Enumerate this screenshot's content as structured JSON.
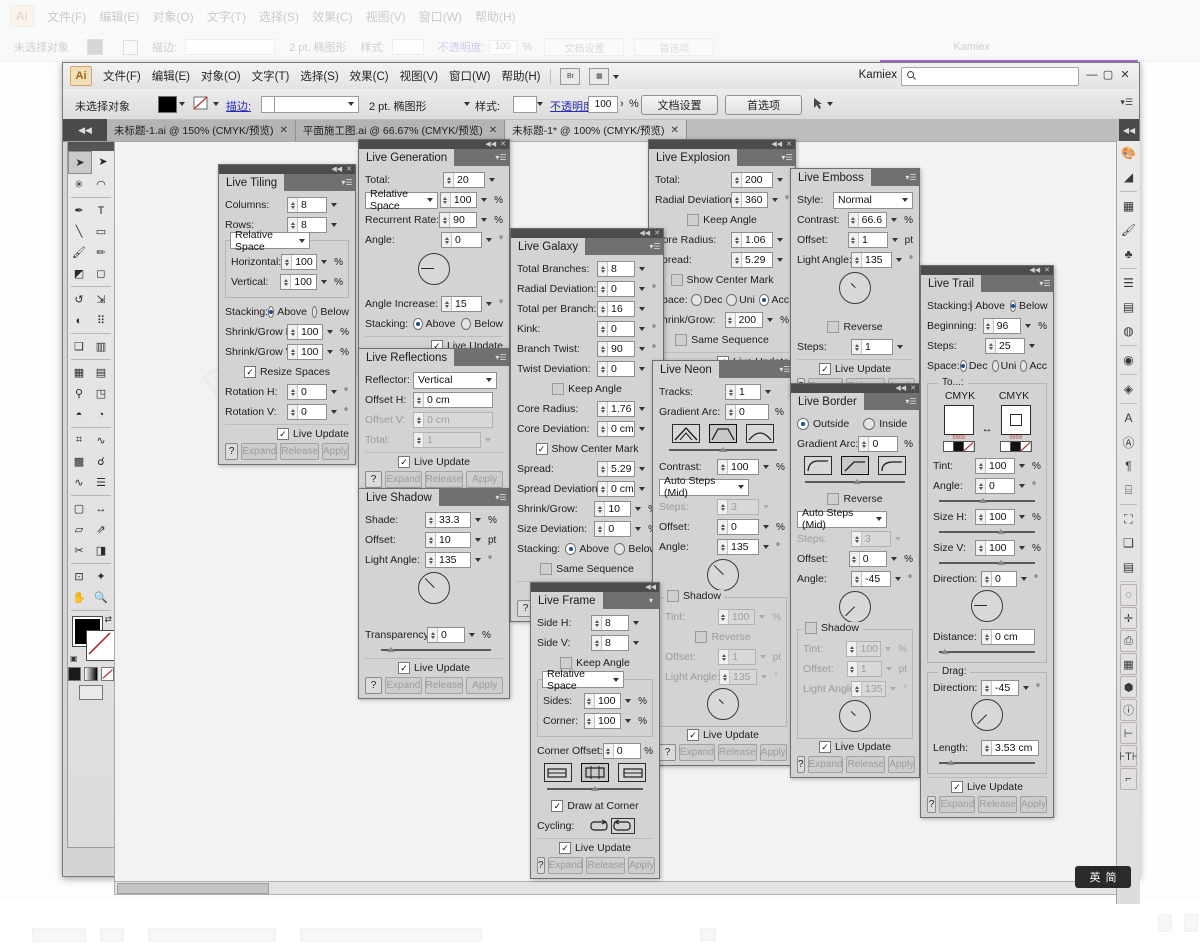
{
  "background_window": {
    "menus": [
      "文件(F)",
      "编辑(E)",
      "对象(O)",
      "文字(T)",
      "选择(S)",
      "效果(C)",
      "视图(V)",
      "窗口(W)",
      "帮助(H)"
    ],
    "logo": "Ai",
    "control": {
      "selection_status": "未选择对象",
      "stroke_label": "描边:",
      "stroke_preset": "2 pt. 椭图形",
      "style_label": "样式:",
      "opacity_label": "不透明度:",
      "opacity_value": "100",
      "percent": "%",
      "doc_setup": "文档设置",
      "preferences": "首选项"
    },
    "user": "Kamiex"
  },
  "window": {
    "logo": "Ai",
    "menus": [
      "文件(F)",
      "编辑(E)",
      "对象(O)",
      "文字(T)",
      "选择(S)",
      "效果(C)",
      "视图(V)",
      "窗口(W)",
      "帮助(H)"
    ],
    "bridge_icon": "Br",
    "arrange_icon": "▦",
    "user": "Kamiex",
    "search_placeholder": "",
    "minimize": "—",
    "maximize": "▢",
    "close": "✕"
  },
  "control_bar": {
    "selection_status": "未选择对象",
    "stroke_label": "描边:",
    "stroke_weight": "2 pt. 椭图形",
    "style_label": "样式:",
    "opacity_label": "不透明度:",
    "opacity_value": "100",
    "percent_sign": "%",
    "doc_setup_button": "文档设置",
    "preferences_button": "首选项"
  },
  "tabs": [
    {
      "label": "未标题-1.ai @ 150% (CMYK/预览)",
      "active": false
    },
    {
      "label": "平面施工图.ai @ 66.67% (CMYK/预览)",
      "active": false
    },
    {
      "label": "未标题-1* @ 100% (CMYK/预览)",
      "active": true
    }
  ],
  "canvas": {
    "watermark": "PHOTOTO CN",
    "watermark2": "图行天下"
  },
  "ime": {
    "lang": "英",
    "mode": "简"
  },
  "common": {
    "live_update": "Live Update",
    "expand": "Expand",
    "release": "Release",
    "apply": "Apply",
    "help": "?",
    "above": "Above",
    "below": "Below",
    "stacking": "Stacking:",
    "keep_angle": "Keep Angle",
    "relative_space": "Relative Space",
    "same_sequence": "Same Sequence",
    "show_center_mark": "Show Center Mark",
    "reverse": "Reverse",
    "shadow": "Shadow",
    "auto_steps_mid": "Auto Steps (Mid)"
  },
  "panels": {
    "live_tiling": {
      "title": "Live Tiling",
      "columns_label": "Columns:",
      "columns_value": "8",
      "rows_label": "Rows:",
      "rows_value": "8",
      "space_mode": "Relative Space",
      "horizontal_label": "Horizontal:",
      "horizontal_value": "100",
      "horizontal_unit": "%",
      "vertical_label": "Vertical:",
      "vertical_value": "100",
      "vertical_unit": "%",
      "stacking_label": "Stacking:",
      "stacking_value": "Above",
      "shrink_h_label": "Shrink/Grow H:",
      "shrink_h_value": "100",
      "shrink_h_unit": "%",
      "shrink_v_label": "Shrink/Grow V:",
      "shrink_v_value": "100",
      "shrink_v_unit": "%",
      "resize_spaces": "Resize Spaces",
      "resize_spaces_checked": true,
      "rotation_h_label": "Rotation H:",
      "rotation_h_value": "0",
      "rotation_h_unit": "°",
      "rotation_v_label": "Rotation V:",
      "rotation_v_value": "0",
      "rotation_v_unit": "°",
      "live_update_checked": true
    },
    "live_generation": {
      "title": "Live Generation",
      "total_label": "Total:",
      "total_value": "20",
      "space_mode": "Relative Space",
      "space_value": "100",
      "space_unit": "%",
      "recurrent_label": "Recurrent Rate:",
      "recurrent_value": "90",
      "recurrent_unit": "%",
      "angle_label": "Angle:",
      "angle_value": "0",
      "angle_unit": "°",
      "angle_increase_label": "Angle Increase:",
      "angle_increase_value": "15",
      "angle_increase_unit": "°",
      "stacking_label": "Stacking:",
      "stacking_value": "Above",
      "live_update_checked": true
    },
    "live_reflections": {
      "title": "Live Reflections",
      "reflector_label": "Reflector:",
      "reflector_value": "Vertical",
      "offset_h_label": "Offset H:",
      "offset_h_value": "0 cm",
      "offset_v_label": "Offset V:",
      "offset_v_value": "0 cm",
      "total_label": "Total:",
      "total_value": "1",
      "live_update_checked": true
    },
    "live_shadow": {
      "title": "Live Shadow",
      "shade_label": "Shade:",
      "shade_value": "33.3",
      "shade_unit": "%",
      "offset_label": "Offset:",
      "offset_value": "10",
      "offset_unit": "pt",
      "light_angle_label": "Light Angle:",
      "light_angle_value": "135",
      "light_angle_unit": "°",
      "transparency_label": "Transparency:",
      "transparency_value": "0",
      "transparency_unit": "%",
      "live_update_checked": true
    },
    "live_galaxy": {
      "title": "Live Galaxy",
      "total_branches_label": "Total Branches:",
      "total_branches_value": "8",
      "radial_dev_label": "Radial Deviation:",
      "radial_dev_value": "0",
      "radial_dev_unit": "°",
      "total_per_branch_label": "Total per Branch:",
      "total_per_branch_value": "16",
      "kink_label": "Kink:",
      "kink_value": "0",
      "kink_unit": "°",
      "branch_twist_label": "Branch Twist:",
      "branch_twist_value": "90",
      "branch_twist_unit": "°",
      "twist_dev_label": "Twist Deviation:",
      "twist_dev_value": "0",
      "twist_dev_unit": "°",
      "keep_angle_checked": false,
      "core_radius_label": "Core Radius:",
      "core_radius_value": "1.76",
      "core_dev_label": "Core Deviation:",
      "core_dev_value": "0 cm",
      "show_center_mark_checked": true,
      "spread_label": "Spread:",
      "spread_value": "5.29",
      "spread_dev_label": "Spread Deviation:",
      "spread_dev_value": "0 cm",
      "shrink_label": "Shrink/Grow:",
      "shrink_value": "10",
      "shrink_unit": "%",
      "size_dev_label": "Size Deviation:",
      "size_dev_value": "0",
      "size_dev_unit": "%",
      "stacking_label": "Stacking:",
      "stacking_value": "Above",
      "same_sequence_checked": false,
      "live_update_checked": true
    },
    "live_frame": {
      "title": "Live Frame",
      "side_h_label": "Side H:",
      "side_h_value": "8",
      "side_v_label": "Side V:",
      "side_v_value": "8",
      "keep_angle_checked": false,
      "space_mode": "Relative Space",
      "sides_label": "Sides:",
      "sides_value": "100",
      "sides_unit": "%",
      "corner_label": "Corner:",
      "corner_value": "100",
      "corner_unit": "%",
      "corner_offset_label": "Corner Offset:",
      "corner_offset_value": "0",
      "corner_offset_unit": "%",
      "draw_at_corner": "Draw at Corner",
      "draw_at_corner_checked": true,
      "cycling_label": "Cycling:",
      "live_update_checked": true
    },
    "live_explosion": {
      "title": "Live Explosion",
      "total_label": "Total:",
      "total_value": "200",
      "radial_dev_label": "Radial Deviation:",
      "radial_dev_value": "360",
      "radial_dev_unit": "°",
      "keep_angle_checked": false,
      "core_radius_label": "Core Radius:",
      "core_radius_value": "1.06",
      "spread_label": "Spread:",
      "spread_value": "5.29",
      "show_center_mark_checked": false,
      "space_label": "Space:",
      "space_dec": "Dec",
      "space_uni": "Uni",
      "space_acc": "Acc",
      "space_selected": "Acc",
      "shrink_label": "Shrink/Grow:",
      "shrink_value": "200",
      "shrink_unit": "%",
      "same_sequence_checked": false,
      "live_update_checked": true
    },
    "live_neon": {
      "title": "Live Neon",
      "tracks_label": "Tracks:",
      "tracks_value": "1",
      "gradient_arc_label": "Gradient Arc:",
      "gradient_arc_value": "0",
      "gradient_arc_unit": "%",
      "contrast_label": "Contrast:",
      "contrast_value": "100",
      "contrast_unit": "%",
      "auto_steps": "Auto Steps (Mid)",
      "steps_label": "Steps:",
      "steps_value": "3",
      "offset_label": "Offset:",
      "offset_value": "0",
      "offset_unit": "%",
      "angle_label": "Angle:",
      "angle_value": "135",
      "angle_unit": "°",
      "shadow_label": "Shadow",
      "shadow_checked": false,
      "tint_label": "Tint:",
      "tint_value": "100",
      "tint_unit": "%",
      "reverse_label": "Reverse",
      "reverse_checked": false,
      "sh_offset_label": "Offset:",
      "sh_offset_value": "1",
      "sh_offset_unit": "pt",
      "light_angle_label": "Light Angle:",
      "light_angle_value": "135",
      "light_angle_unit": "°",
      "live_update_checked": true
    },
    "live_emboss": {
      "title": "Live Emboss",
      "style_label": "Style:",
      "style_value": "Normal",
      "contrast_label": "Contrast:",
      "contrast_value": "66.6",
      "contrast_unit": "%",
      "offset_label": "Offset:",
      "offset_value": "1",
      "offset_unit": "pt",
      "light_angle_label": "Light Angle:",
      "light_angle_value": "135",
      "light_angle_unit": "°",
      "reverse_label": "Reverse",
      "reverse_checked": false,
      "steps_label": "Steps:",
      "steps_value": "1",
      "live_update_checked": true
    },
    "live_border": {
      "title": "Live Border",
      "outside_label": "Outside",
      "inside_label": "Inside",
      "side_selected": "Outside",
      "gradient_arc_label": "Gradient Arc:",
      "gradient_arc_value": "0",
      "gradient_arc_unit": "%",
      "reverse_label": "Reverse",
      "reverse_checked": false,
      "auto_steps": "Auto Steps (Mid)",
      "steps_label": "Steps:",
      "steps_value": "3",
      "offset_label": "Offset:",
      "offset_value": "0",
      "offset_unit": "%",
      "angle_label": "Angle:",
      "angle_value": "-45",
      "angle_unit": "°",
      "shadow_label": "Shadow",
      "shadow_checked": false,
      "tint_label": "Tint:",
      "tint_value": "100",
      "tint_unit": "%",
      "sh_offset_label": "Offset:",
      "sh_offset_value": "1",
      "sh_offset_unit": "pt",
      "light_angle_label": "Light Angle:",
      "light_angle_value": "135",
      "light_angle_unit": "°",
      "live_update_checked": true
    },
    "live_trail": {
      "title": "Live Trail",
      "stacking_label": "Stacking:",
      "stacking_value": "Below",
      "beginning_label": "Beginning:",
      "beginning_value": "96",
      "beginning_unit": "%",
      "steps_label": "Steps:",
      "steps_value": "25",
      "space_label": "Space:",
      "space_dec": "Dec",
      "space_uni": "Uni",
      "space_acc": "Acc",
      "space_selected": "Dec",
      "to_label": "To...:",
      "cmyk_left": "CMYK",
      "cmyk_right": "CMYK",
      "tint_label": "Tint:",
      "tint_value": "100",
      "tint_unit": "%",
      "angle_label": "Angle:",
      "angle_value": "0",
      "angle_unit": "°",
      "size_h_label": "Size H:",
      "size_h_value": "100",
      "size_h_unit": "%",
      "size_v_label": "Size V:",
      "size_v_value": "100",
      "size_v_unit": "%",
      "direction_label": "Direction:",
      "direction_value": "0",
      "direction_unit": "°",
      "distance_label": "Distance:",
      "distance_value": "0 cm",
      "drag_label": "Drag:",
      "drag_direction_label": "Direction:",
      "drag_direction_value": "-45",
      "drag_direction_unit": "°",
      "length_label": "Length:",
      "length_value": "3.53 cm",
      "live_update_checked": true
    }
  },
  "toolbar_icons": [
    "selection-tool",
    "direct-selection-tool",
    "magic-wand-tool",
    "lasso-tool",
    "pen-tool",
    "type-tool",
    "line-tool",
    "rectangle-tool",
    "paintbrush-tool",
    "pencil-tool",
    "blob-brush-tool",
    "eraser-tool",
    "rotate-tool",
    "scale-tool",
    "width-tool",
    "free-transform-tool",
    "symbol-sprayer-tool",
    "column-graph-tool",
    "mesh-tool",
    "gradient-tool",
    "eyedropper-tool",
    "blend-tool",
    "live-paint-bucket-tool",
    "live-paint-selection-tool",
    "perspective-grid-tool",
    "artboard-tool",
    "slice-tool",
    "hand-tool",
    "zoom-tool"
  ],
  "dock_icons": [
    "color-panel-icon",
    "gradient-panel-icon",
    "swatches-panel-icon",
    "brushes-panel-icon",
    "symbols-panel-icon",
    "stroke-panel-icon",
    "gradient-icon",
    "transparency-panel-icon",
    "appearance-panel-icon",
    "layers-panel-icon",
    "character-panel-icon",
    "paragraph-panel-icon",
    "open-type-panel-icon",
    "glyphs-panel-icon",
    "transform-panel-icon",
    "pathfinder-panel-icon",
    "align-panel-icon",
    "lasso-icon",
    "move-icon",
    "artboards-icon",
    "grid-icon",
    "3d-icon",
    "info-icon",
    "indent-icon",
    "text-icon",
    "tab-icon"
  ]
}
